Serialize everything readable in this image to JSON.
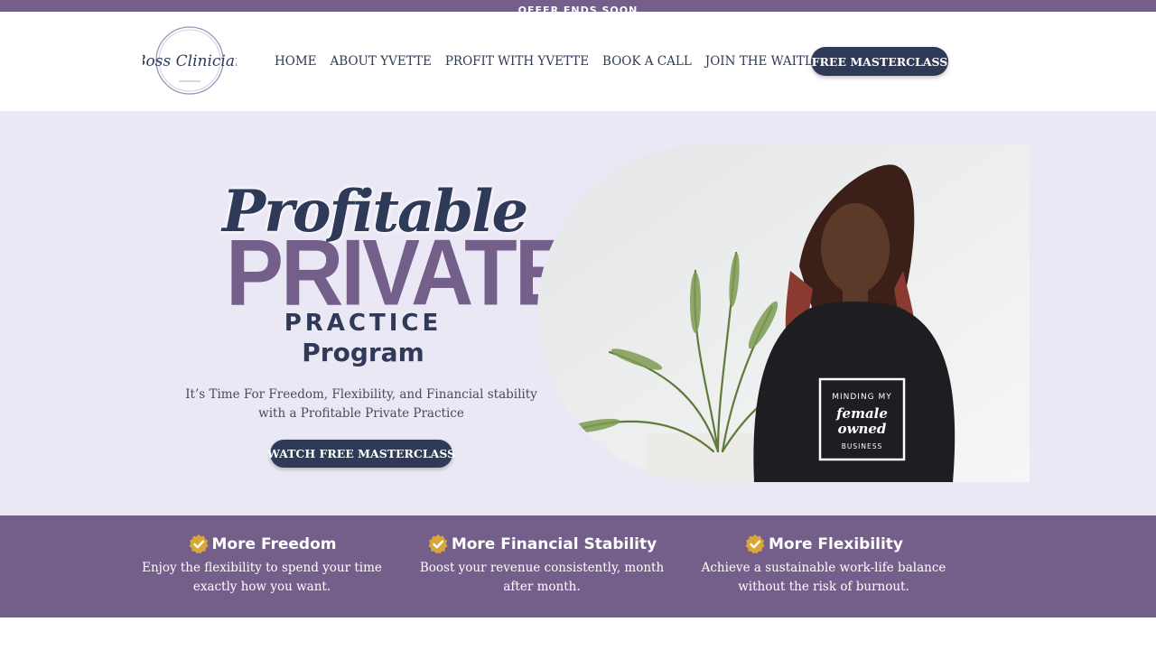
{
  "announcement": {
    "text": "OFFER ENDS SOON"
  },
  "header": {
    "logo_text": "Boss Clinician",
    "nav": [
      {
        "label": "HOME"
      },
      {
        "label": "ABOUT YVETTE"
      },
      {
        "label": "PROFIT WITH YVETTE"
      },
      {
        "label": "BOOK A CALL"
      },
      {
        "label": "JOIN THE WAITLIST"
      }
    ],
    "cta": "FREE MASTERCLASS"
  },
  "hero": {
    "title_script": "Profitable",
    "title_big": "PRIVATE",
    "title_practice": "PRACTICE",
    "title_program": "Program",
    "subtitle": "It’s Time For Freedom, Flexibility, and Financial stability with a Profitable Private Practice",
    "cta": "WATCH FREE MASTERCLASS",
    "shirt_text": [
      "MINDING MY",
      "female",
      "owned",
      "BUSINESS"
    ]
  },
  "features": [
    {
      "icon": "check-badge-icon",
      "title": "More Freedom",
      "text": "Enjoy the flexibility to spend your time exactly how you want."
    },
    {
      "icon": "check-badge-icon",
      "title": "More Financial Stability",
      "text": "Boost your revenue consistently, month after month."
    },
    {
      "icon": "check-badge-icon",
      "title": "More Flexibility",
      "text": "Achieve a sustainable work-life balance without the risk of burnout."
    }
  ],
  "colors": {
    "navy": "#2e3a57",
    "purple": "#735f8a",
    "hero_bg": "#ebe8f5",
    "gold": "#d9a63a"
  }
}
